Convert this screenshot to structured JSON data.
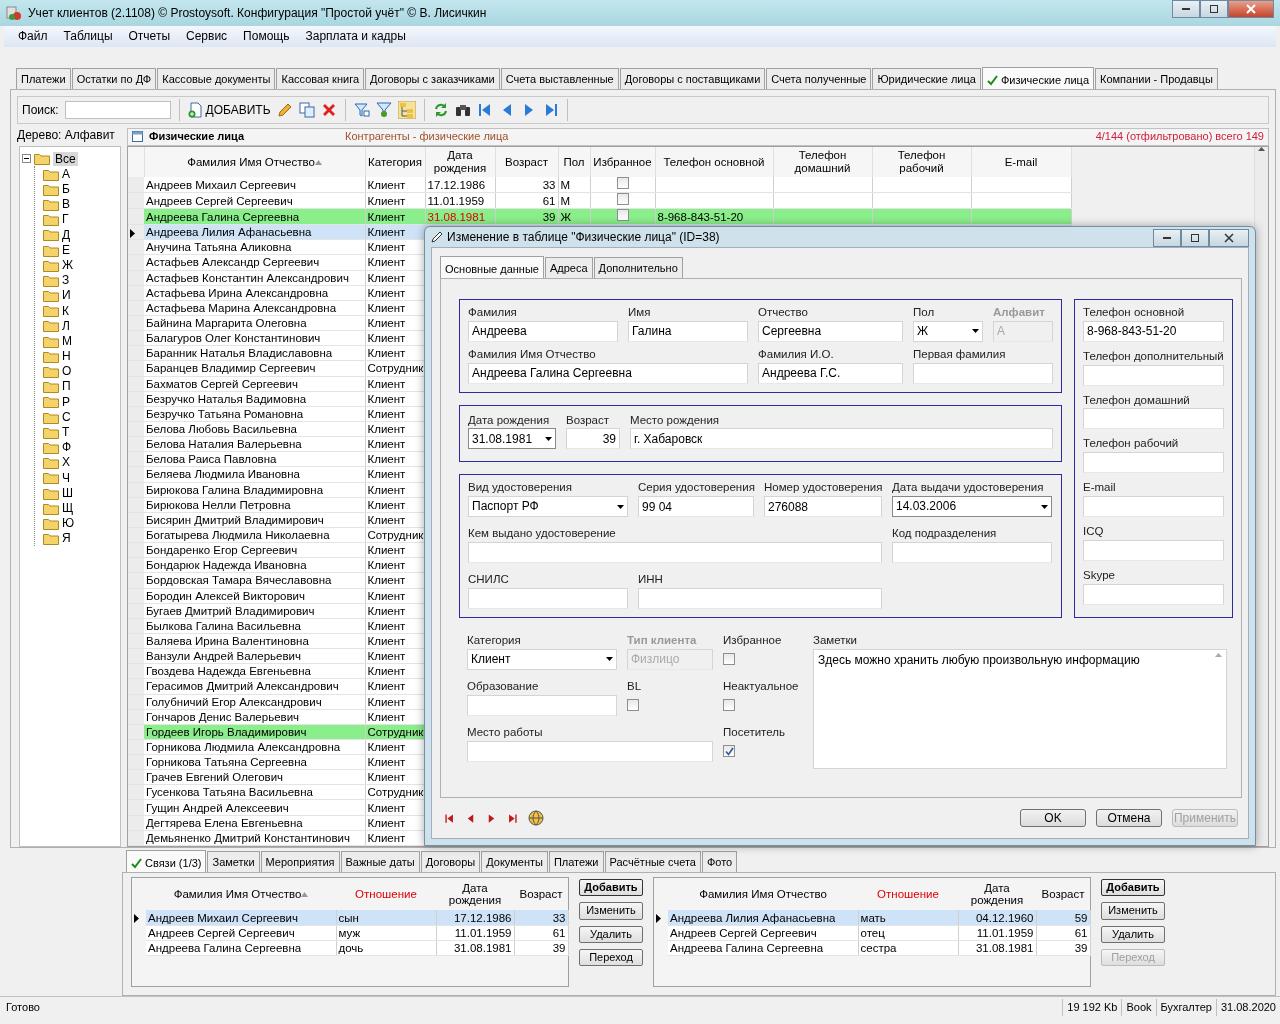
{
  "window": {
    "title": "Учет клиентов (2.1108) © Prostoysoft. Конфигурация \"Простой учёт\" © В. Лисичкин"
  },
  "menu": [
    "Файл",
    "Таблицы",
    "Отчеты",
    "Сервис",
    "Помощь",
    "Зарплата и кадры"
  ],
  "tabs": [
    {
      "label": "Платежи",
      "selected": false
    },
    {
      "label": "Остатки по ДФ",
      "selected": false
    },
    {
      "label": "Кассовые документы",
      "selected": false
    },
    {
      "label": "Кассовая книга",
      "selected": false
    },
    {
      "label": "Договоры с заказчиками",
      "selected": false
    },
    {
      "label": "Счета выставленные",
      "selected": false
    },
    {
      "label": "Договоры с поставщиками",
      "selected": false
    },
    {
      "label": "Счета полученные",
      "selected": false
    },
    {
      "label": "Юридические лица",
      "selected": false
    },
    {
      "label": "Физические лица",
      "selected": true
    },
    {
      "label": "Компании - Продавцы",
      "selected": false
    }
  ],
  "toolbar": {
    "search_label": "Поиск:",
    "add_button": "ДОБАВИТЬ"
  },
  "tree": {
    "label": "Дерево: Алфавит",
    "root": {
      "label": "Все",
      "expanded": true,
      "selected": true,
      "children": [
        {
          "label": "А"
        },
        {
          "label": "Б"
        },
        {
          "label": "В"
        },
        {
          "label": "Г"
        },
        {
          "label": "Д"
        },
        {
          "label": "Е"
        },
        {
          "label": "Ж"
        },
        {
          "label": "З"
        },
        {
          "label": "И"
        },
        {
          "label": "К"
        },
        {
          "label": "Л"
        },
        {
          "label": "М"
        },
        {
          "label": "Н"
        },
        {
          "label": "О"
        },
        {
          "label": "П"
        },
        {
          "label": "Р"
        },
        {
          "label": "С"
        },
        {
          "label": "Т"
        },
        {
          "label": "Ф"
        },
        {
          "label": "Х"
        },
        {
          "label": "Ч"
        },
        {
          "label": "Ш"
        },
        {
          "label": "Щ"
        },
        {
          "label": "Ю"
        },
        {
          "label": "Я"
        }
      ]
    }
  },
  "grid": {
    "title": "Физические лица",
    "subtitle": "Контрагенты - физические лица",
    "counter": "4/144 (отфильтровано) всего 149",
    "columns": [
      {
        "label": "Фамилия Имя Отчество",
        "sorted": true
      },
      {
        "label": "Категория",
        "sorted": false
      },
      {
        "label": "Дата рождения",
        "sorted": false
      },
      {
        "label": "Возраст",
        "sorted": false
      },
      {
        "label": "Пол",
        "sorted": false
      },
      {
        "label": "Избранное",
        "sorted": false
      },
      {
        "label": "Телефон основной",
        "sorted": false
      },
      {
        "label": "Телефон домашний",
        "sorted": false
      },
      {
        "label": "Телефон рабочий",
        "sorted": false
      },
      {
        "label": "E-mail",
        "sorted": false
      }
    ],
    "rows": [
      {
        "name": "Андреев Михаил Сергеевич",
        "category": "Клиент",
        "birth": "17.12.1986",
        "age": "33",
        "sex": "М",
        "favorite": false,
        "current": false,
        "highlighted": false
      },
      {
        "name": "Андреев Сергей Сергеевич",
        "category": "Клиент",
        "birth": "11.01.1959",
        "age": "61",
        "sex": "М",
        "favorite": false,
        "current": false,
        "highlighted": false
      },
      {
        "name": "Андреева Галина Сергеевна",
        "category": "Клиент",
        "birth": "31.08.1981",
        "age": "39",
        "sex": "Ж",
        "favorite": false,
        "phone": "8-968-843-51-20",
        "current": false,
        "highlighted": true
      },
      {
        "name": "Андреева Лилия Афанасьевна",
        "category": "Клиент",
        "current": true,
        "highlighted": false
      },
      {
        "name": "Анучина Татьяна Аликовна",
        "category": "Клиент",
        "current": false,
        "highlighted": false
      },
      {
        "name": "Астафьев Александр Сергеевич",
        "category": "Клиент",
        "current": false,
        "highlighted": false
      },
      {
        "name": "Астафьев Константин Александрович",
        "category": "Клиент",
        "current": false,
        "highlighted": false
      },
      {
        "name": "Астафьева Ирина Александровна",
        "category": "Клиент",
        "current": false,
        "highlighted": false
      },
      {
        "name": "Астафьева Марина Александровна",
        "category": "Клиент",
        "current": false,
        "highlighted": false
      },
      {
        "name": "Байнина Маргарита Олеговна",
        "category": "Клиент",
        "current": false,
        "highlighted": false
      },
      {
        "name": "Балагуров Олег Константинович",
        "category": "Клиент",
        "current": false,
        "highlighted": false
      },
      {
        "name": "Баранник Наталья Владиславовна",
        "category": "Клиент",
        "current": false,
        "highlighted": false
      },
      {
        "name": "Баранцев Владимир Сергеевич",
        "category": "Сотрудник",
        "current": false,
        "highlighted": false
      },
      {
        "name": "Бахматов Сергей Сергеевич",
        "category": "Клиент",
        "current": false,
        "highlighted": false
      },
      {
        "name": "Безручко Наталья Вадимовна",
        "category": "Клиент",
        "current": false,
        "highlighted": false
      },
      {
        "name": "Безручко Татьяна Романовна",
        "category": "Клиент",
        "current": false,
        "highlighted": false
      },
      {
        "name": "Белова Любовь Васильевна",
        "category": "Клиент",
        "current": false,
        "highlighted": false
      },
      {
        "name": "Белова Наталия Валерьевна",
        "category": "Клиент",
        "current": false,
        "highlighted": false
      },
      {
        "name": "Белова Раиса Павловна",
        "category": "Клиент",
        "current": false,
        "highlighted": false
      },
      {
        "name": "Беляева Людмила Ивановна",
        "category": "Клиент",
        "current": false,
        "highlighted": false
      },
      {
        "name": "Бирюкова Галина Владимировна",
        "category": "Клиент",
        "current": false,
        "highlighted": false
      },
      {
        "name": "Бирюкова Нелли Петровна",
        "category": "Клиент",
        "current": false,
        "highlighted": false
      },
      {
        "name": "Бисярин Дмитрий Владимирович",
        "category": "Клиент",
        "current": false,
        "highlighted": false
      },
      {
        "name": "Богатырева Людмила Николаевна",
        "category": "Сотрудник",
        "current": false,
        "highlighted": false
      },
      {
        "name": "Бондаренко Егор Сергеевич",
        "category": "Клиент",
        "current": false,
        "highlighted": false
      },
      {
        "name": "Бондарюк Надежда Ивановна",
        "category": "Клиент",
        "current": false,
        "highlighted": false
      },
      {
        "name": "Бордовская Тамара Вячеславовна",
        "category": "Клиент",
        "current": false,
        "highlighted": false
      },
      {
        "name": "Бородин Алексей Викторович",
        "category": "Клиент",
        "current": false,
        "highlighted": false
      },
      {
        "name": "Бугаев Дмитрий Владимирович",
        "category": "Клиент",
        "current": false,
        "highlighted": false
      },
      {
        "name": "Былкова Галина Васильевна",
        "category": "Клиент",
        "current": false,
        "highlighted": false
      },
      {
        "name": "Валяева Ирина Валентиновна",
        "category": "Клиент",
        "current": false,
        "highlighted": false
      },
      {
        "name": "Ванзули Андрей Валерьевич",
        "category": "Клиент",
        "current": false,
        "highlighted": false
      },
      {
        "name": "Гвоздева Надежда Евгеньевна",
        "category": "Клиент",
        "current": false,
        "highlighted": false
      },
      {
        "name": "Герасимов Дмитрий Александрович",
        "category": "Клиент",
        "current": false,
        "highlighted": false
      },
      {
        "name": "Голубничий Егор Александрович",
        "category": "Клиент",
        "current": false,
        "highlighted": false
      },
      {
        "name": "Гончаров Денис Валерьевич",
        "category": "Клиент",
        "current": false,
        "highlighted": false
      },
      {
        "name": "Гордеев Игорь Владимирович",
        "category": "Сотрудник",
        "current": false,
        "highlighted": true
      },
      {
        "name": "Горникова Людмила Александровна",
        "category": "Клиент",
        "current": false,
        "highlighted": false
      },
      {
        "name": "Горникова Татьяна Сергеевна",
        "category": "Клиент",
        "current": false,
        "highlighted": false
      },
      {
        "name": "Грачев Евгений Олегович",
        "category": "Клиент",
        "current": false,
        "highlighted": false
      },
      {
        "name": "Гусенкова Татьяна Васильевна",
        "category": "Сотрудник",
        "current": false,
        "highlighted": false
      },
      {
        "name": "Гущин Андрей Алексеевич",
        "category": "Клиент",
        "current": false,
        "highlighted": false
      },
      {
        "name": "Дегтярева Елена Евгеньевна",
        "category": "Клиент",
        "current": false,
        "highlighted": false
      },
      {
        "name": "Демьяненко Дмитрий Константинович",
        "category": "Клиент",
        "current": false,
        "highlighted": false
      }
    ]
  },
  "dialog": {
    "title": "Изменение в таблице \"Физические лица\" (ID=38)",
    "tabs": [
      {
        "label": "Основные данные",
        "selected": true
      },
      {
        "label": "Адреса",
        "selected": false
      },
      {
        "label": "Дополнительно",
        "selected": false
      }
    ],
    "groups": [
      [
        {
          "kind": "text",
          "label": "Фамилия",
          "value": "Андреева",
          "disabled": false
        },
        {
          "kind": "text",
          "label": "Имя",
          "value": "Галина",
          "disabled": false
        },
        {
          "kind": "text",
          "label": "Отчество",
          "value": "Сергеевна",
          "disabled": false
        },
        {
          "kind": "combo",
          "label": "Пол",
          "value": "Ж",
          "disabled": false
        },
        {
          "kind": "text",
          "label": "Алфавит",
          "value": "А",
          "disabled": true
        },
        {
          "kind": "text",
          "label": "Фамилия Имя Отчество",
          "value": "Андреева Галина Сергеевна",
          "disabled": false
        },
        {
          "kind": "text",
          "label": "Фамилия И.О.",
          "value": "Андреева Г.С.",
          "disabled": false
        },
        {
          "kind": "text",
          "label": "Первая фамилия",
          "disabled": false
        }
      ],
      [
        {
          "kind": "date",
          "label": "Дата рождения",
          "value": "31.08.1981",
          "disabled": false
        },
        {
          "kind": "number",
          "label": "Возраст",
          "value": "39",
          "disabled": false
        },
        {
          "kind": "text",
          "label": "Место рождения",
          "value": "г. Хабаровск",
          "disabled": false
        }
      ],
      [
        {
          "kind": "combo",
          "label": "Вид удостоверения",
          "value": "Паспорт РФ",
          "disabled": false
        },
        {
          "kind": "text",
          "label": "Серия удостоверения",
          "value": "99 04",
          "disabled": false
        },
        {
          "kind": "text",
          "label": "Номер удостоверения",
          "value": "276088",
          "disabled": false
        },
        {
          "kind": "date",
          "label": "Дата выдачи удостоверения",
          "value": "14.03.2006",
          "disabled": false
        },
        {
          "kind": "text",
          "label": "Кем выдано удостоверение",
          "disabled": false
        },
        {
          "kind": "text",
          "label": "Код подразделения",
          "disabled": false
        },
        {
          "kind": "text",
          "label": "СНИЛС",
          "disabled": false
        },
        {
          "kind": "text",
          "label": "ИНН",
          "disabled": false
        }
      ]
    ],
    "phones": [
      {
        "kind": "text",
        "label": "Телефон основной",
        "value": "8-968-843-51-20",
        "disabled": false
      },
      {
        "kind": "text",
        "label": "Телефон дополнительный",
        "disabled": false
      },
      {
        "kind": "text",
        "label": "Телефон домашний",
        "disabled": false
      },
      {
        "kind": "text",
        "label": "Телефон рабочий",
        "disabled": false
      },
      {
        "kind": "text",
        "label": "E-mail",
        "disabled": false
      },
      {
        "kind": "text",
        "label": "ICQ",
        "disabled": false
      },
      {
        "kind": "text",
        "label": "Skype",
        "disabled": false
      }
    ],
    "bottom": [
      {
        "kind": "combo",
        "label": "Категория",
        "value": "Клиент",
        "disabled": false
      },
      {
        "kind": "text",
        "label": "Тип клиента",
        "value": "Физлицо",
        "disabled": true
      },
      {
        "kind": "check",
        "label": "Избранное",
        "checked": false
      },
      {
        "kind": "memo",
        "label": "Заметки",
        "value": "Здесь можно хранить любую произвольную информацию",
        "disabled": false
      },
      {
        "kind": "text",
        "label": "Образование",
        "disabled": false
      },
      {
        "kind": "check",
        "label": "BL",
        "checked": false
      },
      {
        "kind": "check",
        "label": "Неактуальное",
        "checked": false
      },
      {
        "kind": "text",
        "label": "Место работы",
        "disabled": false
      },
      {
        "kind": "check",
        "label": "Посетитель",
        "checked": true
      }
    ],
    "buttons": [
      {
        "label": "OK",
        "disabled": false
      },
      {
        "label": "Отмена",
        "disabled": false
      },
      {
        "label": "Применить",
        "disabled": true
      }
    ]
  },
  "bottom_panel": {
    "tabs": [
      {
        "label": "Связи (1/3)",
        "selected": true
      },
      {
        "label": "Заметки",
        "selected": false
      },
      {
        "label": "Мероприятия",
        "selected": false
      },
      {
        "label": "Важные даты",
        "selected": false
      },
      {
        "label": "Договоры",
        "selected": false
      },
      {
        "label": "Документы",
        "selected": false
      },
      {
        "label": "Платежи",
        "selected": false
      },
      {
        "label": "Расчётные счета",
        "selected": false
      },
      {
        "label": "Фото",
        "selected": false
      }
    ],
    "tables": [
      {
        "columns": [
          {
            "label": "Фамилия Имя Отчество",
            "sorted": true,
            "highlighted": false
          },
          {
            "label": "Отношение",
            "sorted": false,
            "highlighted": true
          },
          {
            "label": "Дата рождения",
            "sorted": false,
            "highlighted": false
          },
          {
            "label": "Возраст",
            "sorted": false,
            "highlighted": false
          }
        ],
        "rows": [
          {
            "cells": [
              "Андреев Михаил Сергеевич",
              "сын",
              "17.12.1986",
              "33"
            ],
            "current": true
          },
          {
            "cells": [
              "Андреев Сергей Сергеевич",
              "муж",
              "11.01.1959",
              "61"
            ],
            "current": false
          },
          {
            "cells": [
              "Андреева Галина Сергеевна",
              "дочь",
              "31.08.1981",
              "39"
            ],
            "current": false
          }
        ],
        "buttons": [
          {
            "label": "Добавить",
            "default": true,
            "disabled": false
          },
          {
            "label": "Изменить",
            "default": false,
            "disabled": false
          },
          {
            "label": "Удалить",
            "default": false,
            "disabled": false
          },
          {
            "label": "Переход",
            "default": false,
            "disabled": false
          }
        ]
      },
      {
        "columns": [
          {
            "label": "Фамилия Имя Отчество",
            "sorted": false,
            "highlighted": false
          },
          {
            "label": "Отношение",
            "sorted": false,
            "highlighted": true
          },
          {
            "label": "Дата рождения",
            "sorted": false,
            "highlighted": false
          },
          {
            "label": "Возраст",
            "sorted": false,
            "highlighted": false
          }
        ],
        "rows": [
          {
            "cells": [
              "Андреева Лилия Афанасьевна",
              "мать",
              "04.12.1960",
              "59"
            ],
            "current": true
          },
          {
            "cells": [
              "Андреев Сергей Сергеевич",
              "отец",
              "11.01.1959",
              "61"
            ],
            "current": false
          },
          {
            "cells": [
              "Андреева Галина Сергеевна",
              "сестра",
              "31.08.1981",
              "39"
            ],
            "current": false
          }
        ],
        "buttons": [
          {
            "label": "Добавить",
            "default": true,
            "disabled": false
          },
          {
            "label": "Изменить",
            "default": false,
            "disabled": false
          },
          {
            "label": "Удалить",
            "default": false,
            "disabled": false
          },
          {
            "label": "Переход",
            "default": false,
            "disabled": true
          }
        ]
      }
    ]
  },
  "status_bar": {
    "message": "Готово",
    "cells": [
      "19 192 Kb",
      "Book",
      "Бухгалтер",
      "31.08.2020"
    ]
  }
}
